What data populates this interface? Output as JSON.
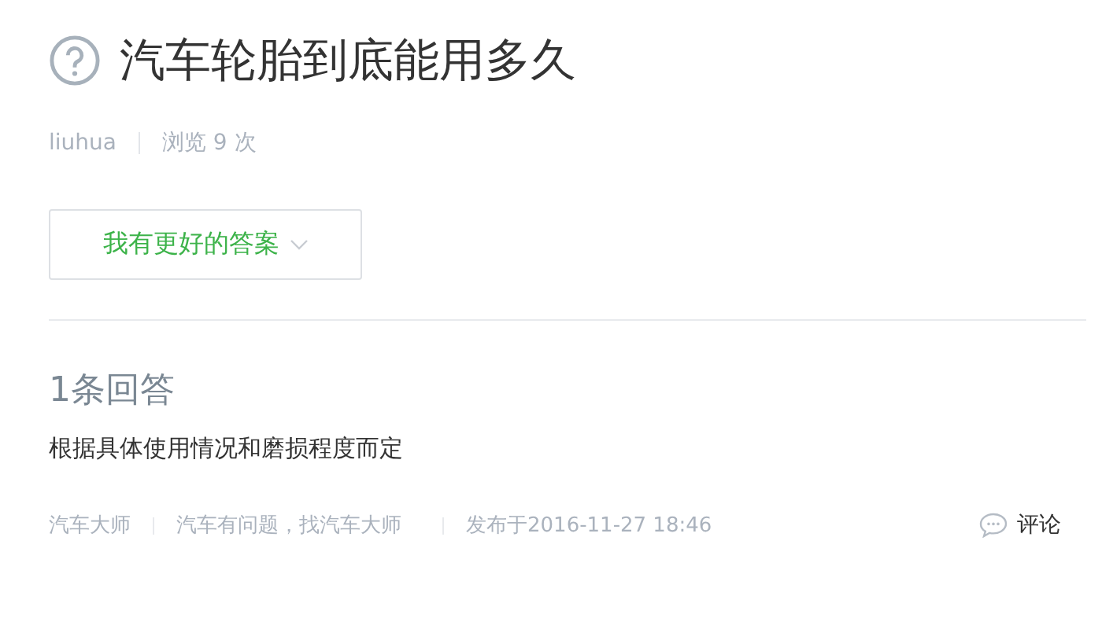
{
  "question": {
    "title": "汽车轮胎到底能用多久",
    "author": "liuhua",
    "views": "浏览 9 次"
  },
  "better_answer_button": {
    "label": "我有更好的答案"
  },
  "answer_count": "1条回答",
  "answers": [
    {
      "text": "根据具体使用情况和磨损程度而定",
      "author": "汽车大师",
      "slogan": "汽车有问题，找汽车大师",
      "published": "发布于2016-11-27 18:46",
      "comment": "评论"
    }
  ]
}
